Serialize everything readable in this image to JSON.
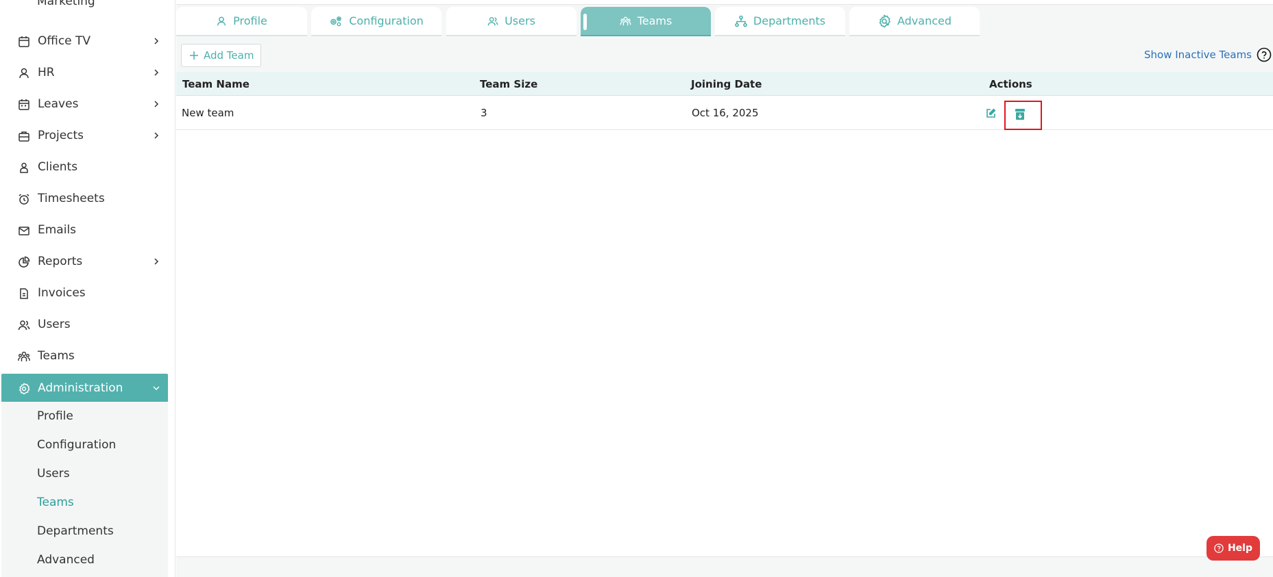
{
  "sidebar": {
    "partial_item": "Marketing",
    "items": [
      {
        "label": "Office TV",
        "icon": "calendar-icon",
        "has_chevron": true
      },
      {
        "label": "HR",
        "icon": "person-icon",
        "has_chevron": true
      },
      {
        "label": "Leaves",
        "icon": "calendar-grid-icon",
        "has_chevron": true
      },
      {
        "label": "Projects",
        "icon": "briefcase-icon",
        "has_chevron": true
      },
      {
        "label": "Clients",
        "icon": "client-icon",
        "has_chevron": false
      },
      {
        "label": "Timesheets",
        "icon": "alarm-clock-icon",
        "has_chevron": false
      },
      {
        "label": "Emails",
        "icon": "mail-icon",
        "has_chevron": false
      },
      {
        "label": "Reports",
        "icon": "pie-chart-icon",
        "has_chevron": true
      },
      {
        "label": "Invoices",
        "icon": "invoice-icon",
        "has_chevron": false
      },
      {
        "label": "Users",
        "icon": "users-icon",
        "has_chevron": false
      },
      {
        "label": "Teams",
        "icon": "teams-icon",
        "has_chevron": false
      },
      {
        "label": "Administration",
        "icon": "admin-gear-icon",
        "has_chevron": true,
        "active": true
      }
    ],
    "submenu": [
      "Profile",
      "Configuration",
      "Users",
      "Teams",
      "Departments",
      "Advanced"
    ],
    "submenu_active": "Teams"
  },
  "tabs": [
    {
      "label": "Profile",
      "icon": "person-icon"
    },
    {
      "label": "Configuration",
      "icon": "gears-icon"
    },
    {
      "label": "Users",
      "icon": "users-icon"
    },
    {
      "label": "Teams",
      "icon": "teams-icon",
      "active": true
    },
    {
      "label": "Departments",
      "icon": "org-chart-icon"
    },
    {
      "label": "Advanced",
      "icon": "advanced-gear-icon"
    }
  ],
  "toolbar": {
    "add_team_label": "Add Team",
    "show_inactive_label": "Show Inactive Teams"
  },
  "table": {
    "headers": [
      "Team Name",
      "Team Size",
      "Joining Date",
      "Actions"
    ],
    "rows": [
      {
        "team_name": "New team",
        "team_size": "3",
        "joining_date": "Oct 16, 2025"
      }
    ]
  },
  "help": {
    "label": "Help"
  },
  "colors": {
    "accent": "#52b1ad",
    "accent_text": "#4bb0ab",
    "link": "#2a6fb8",
    "highlight_box": "#e0141e",
    "help_button": "#e23b3b"
  }
}
